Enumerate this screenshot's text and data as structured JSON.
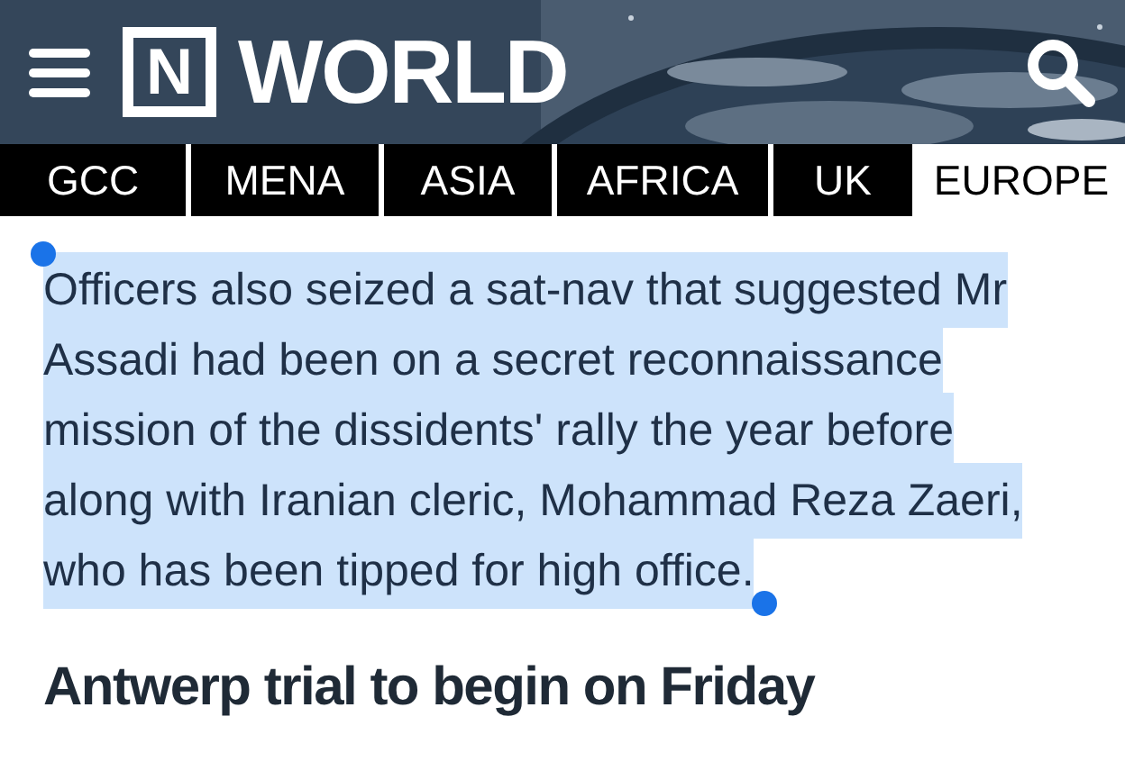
{
  "header": {
    "logo_mark": "N",
    "title": "WORLD"
  },
  "tabs": [
    {
      "label": "GCC",
      "selected": false
    },
    {
      "label": "MENA",
      "selected": false
    },
    {
      "label": "ASIA",
      "selected": false
    },
    {
      "label": "AFRICA",
      "selected": false
    },
    {
      "label": "UK",
      "selected": false
    },
    {
      "label": "EUROPE",
      "selected": true
    }
  ],
  "article": {
    "paragraph": {
      "text": "Officers also seized a sat-nav that suggested Mr Assadi had been on a secret reconnaissance mission of the dissidents' rally the year before along with Iranian cleric, Mohammad Reza Zaeri, who has been tipped for high office.",
      "selected": true
    },
    "heading": "Antwerp trial to begin on Friday"
  }
}
